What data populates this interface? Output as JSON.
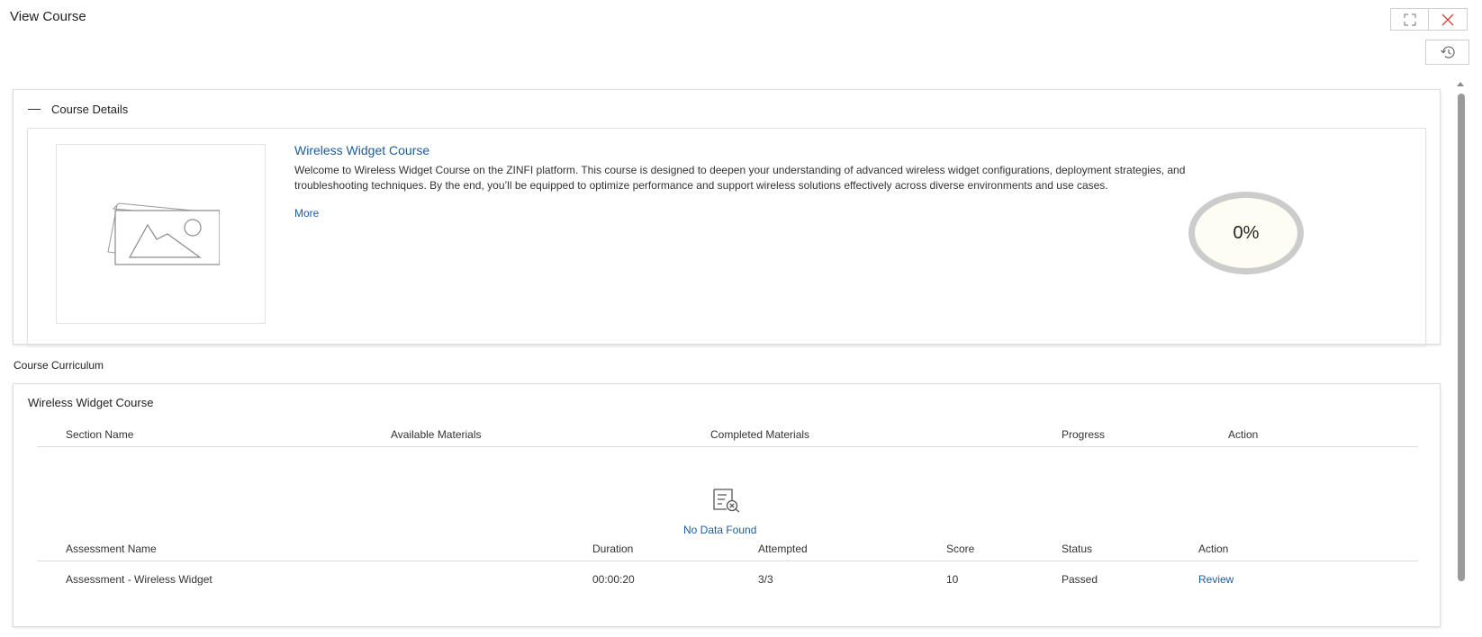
{
  "header": {
    "title": "View Course",
    "fullscreen_icon": "expand-icon",
    "close_icon": "close-icon",
    "history_icon": "history-icon"
  },
  "details": {
    "section_title": "Course Details",
    "course_name": "Wireless Widget Course",
    "description": "Welcome to Wireless Widget Course on the ZINFI platform. This course is designed to deepen your understanding of advanced wireless widget configurations, deployment strategies, and troubleshooting techniques. By the end, you’ll be equipped to optimize performance and support wireless solutions effectively across diverse environments and use cases.",
    "more_label": "More",
    "progress_label": "0%",
    "progress_value": 0
  },
  "curriculum": {
    "label": "Course Curriculum",
    "course_title": "Wireless Widget Course",
    "sections_table": {
      "columns": [
        "Section Name",
        "Available Materials",
        "Completed Materials",
        "Progress",
        "Action"
      ],
      "empty_text": "No Data Found"
    },
    "assessments_table": {
      "columns": [
        "Assessment Name",
        "Duration",
        "Attempted",
        "Score",
        "Status",
        "Action"
      ],
      "rows": [
        {
          "name": "Assessment - Wireless Widget",
          "duration": "00:00:20",
          "attempted": "3/3",
          "score": "10",
          "status": "Passed",
          "action": "Review"
        }
      ]
    }
  },
  "colors": {
    "link": "#1c5b9c",
    "close_red": "#d9443c"
  }
}
